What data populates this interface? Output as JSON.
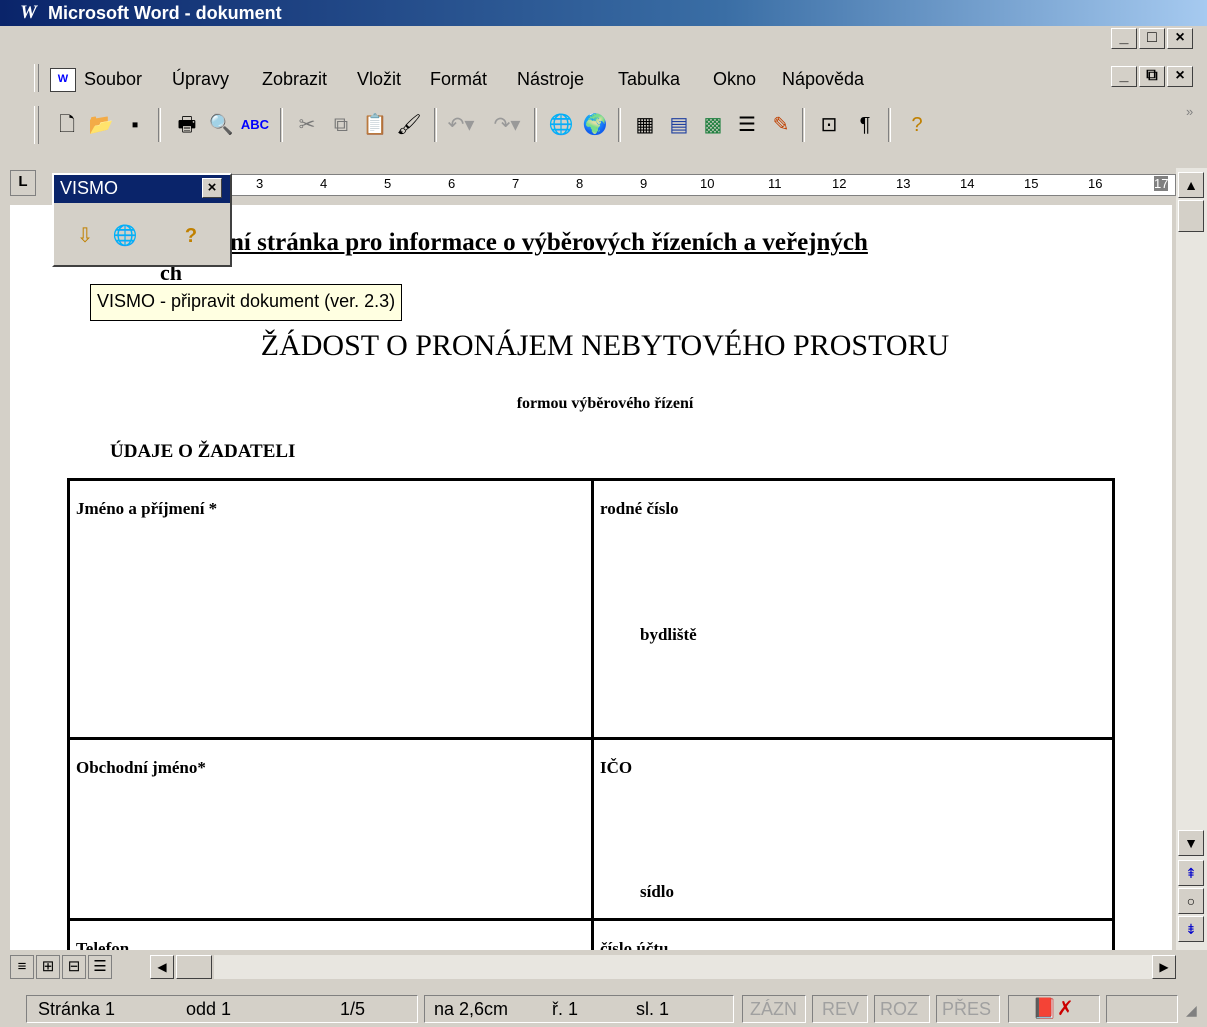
{
  "window": {
    "title": "Microsoft Word - dokument",
    "app_icon": "W"
  },
  "window_controls": {
    "minimize": "_",
    "maximize": "□",
    "close": "×"
  },
  "doc_controls": {
    "minimize": "_",
    "restore": "⧉",
    "close": "×"
  },
  "menu": [
    "Soubor",
    "Úpravy",
    "Zobrazit",
    "Vložit",
    "Formát",
    "Nástroje",
    "Tabulka",
    "Okno",
    "Nápověda"
  ],
  "toolbar": [
    "new-icon",
    "open-icon",
    "save-icon",
    "print-icon",
    "print-preview-icon",
    "spelling-icon",
    "cut-icon",
    "copy-icon",
    "paste-icon",
    "format-painter-icon",
    "undo-icon",
    "redo-icon",
    "hyperlink-icon",
    "web-toolbar-icon",
    "tables-borders-icon",
    "insert-table-icon",
    "insert-excel-icon",
    "columns-icon",
    "drawing-icon",
    "document-map-icon",
    "show-formatting-icon",
    "help-icon"
  ],
  "ruler": {
    "numbers": [
      "3",
      "4",
      "5",
      "6",
      "7",
      "8",
      "9",
      "10",
      "11",
      "12",
      "13",
      "14",
      "15",
      "16",
      "17"
    ]
  },
  "vismo": {
    "title": "VISMO",
    "close": "×",
    "tooltip": "VISMO - připravit dokument (ver. 2.3)"
  },
  "document": {
    "heading": "ní stránka pro informace o výběrových řízeních a veřejných",
    "heading_cont": "ch",
    "title": "ŽÁDOST O PRONÁJEM NEBYTOVÉHO PROSTORU",
    "subtitle": "formou výběrového řízení",
    "section": "ÚDAJE O ŽADATELI",
    "table": {
      "name_label": "Jméno a příjmení *",
      "birth_label": "rodné číslo",
      "residence_label": "bydliště",
      "company_label": "Obchodní jméno*",
      "ico_label": "IČO",
      "seat_label": "sídlo",
      "phone_label": "Telefon",
      "account_label": "číslo účtu"
    }
  },
  "status": {
    "page": "Stránka 1",
    "section": "odd 1",
    "pages": "1/5",
    "position": "na 2,6cm",
    "line": "ř. 1",
    "column": "sl. 1",
    "rec": "ZÁZN",
    "rev": "REV",
    "ext": "ROZ",
    "ovr": "PŘES"
  }
}
